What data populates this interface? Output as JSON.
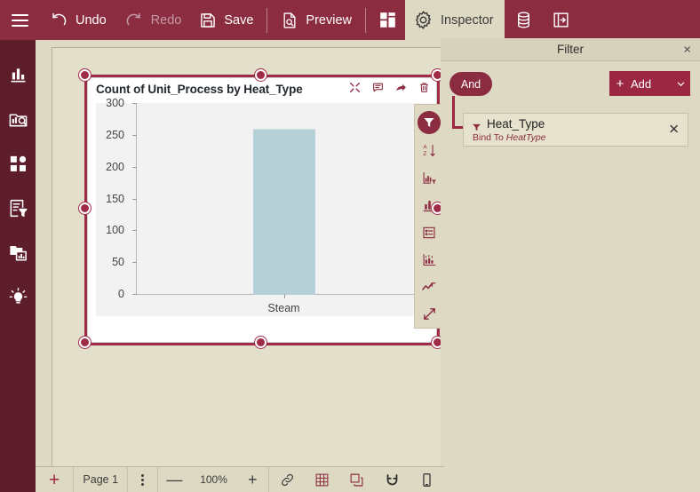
{
  "toolbar": {
    "menu_icon": "hamburger-icon",
    "items": [
      {
        "label": "Undo",
        "icon": "undo-icon",
        "enabled": true
      },
      {
        "label": "Redo",
        "icon": "redo-icon",
        "enabled": false
      },
      {
        "label": "Save",
        "icon": "save-icon",
        "enabled": true
      },
      {
        "label": "Preview",
        "icon": "preview-icon",
        "enabled": true
      }
    ],
    "layout_icon": "layout-grid-icon",
    "inspector_label": "Inspector",
    "inspector_icon": "gear-icon",
    "data_icon": "database-icon",
    "panel_icon": "side-panel-icon",
    "background": "#8c2c40",
    "active_background": "#ddd9c3"
  },
  "sidebar": {
    "background": "#5e1d2b",
    "items": [
      {
        "name": "sidebar-item-charts",
        "icon": "bar-chart-icon"
      },
      {
        "name": "sidebar-item-explore",
        "icon": "chart-search-icon"
      },
      {
        "name": "sidebar-item-components",
        "icon": "grid-shapes-icon"
      },
      {
        "name": "sidebar-item-filters",
        "icon": "form-filter-icon"
      },
      {
        "name": "sidebar-item-datasets",
        "icon": "folder-chart-icon"
      },
      {
        "name": "sidebar-item-insights",
        "icon": "lightbulb-icon"
      }
    ]
  },
  "chart_data": {
    "type": "bar",
    "title": "Count of Unit_Process by Heat_Type",
    "categories": [
      "Steam"
    ],
    "values": [
      260
    ],
    "xlabel": "",
    "ylabel": "",
    "ylim": [
      0,
      300
    ],
    "yticks": [
      0,
      50,
      100,
      150,
      200,
      250,
      300
    ],
    "grid": false,
    "legend": false,
    "bar_color": "#b5d0d7",
    "plot_background": "#f2f2f2"
  },
  "widget": {
    "selected": true,
    "icons": [
      {
        "name": "expand-icon",
        "label": "Expand"
      },
      {
        "name": "comment-icon",
        "label": "Comment"
      },
      {
        "name": "share-icon",
        "label": "Share"
      },
      {
        "name": "delete-icon",
        "label": "Delete"
      }
    ],
    "tools": [
      {
        "name": "filter-icon",
        "selected": true
      },
      {
        "name": "sort-az-icon",
        "selected": false
      },
      {
        "name": "chart-filter-icon",
        "selected": false
      },
      {
        "name": "bar-chart-icon",
        "selected": false
      },
      {
        "name": "table-icon",
        "selected": false
      },
      {
        "name": "statistics-icon",
        "selected": false
      },
      {
        "name": "trend-line-icon",
        "selected": false
      },
      {
        "name": "resize-icon",
        "selected": false
      }
    ]
  },
  "filter_panel": {
    "title": "Filter",
    "close_label": "×",
    "operator": "And",
    "add_label": "Add",
    "add_plus": "+",
    "add_caret": "⌄",
    "cards": [
      {
        "name": "Heat_Type",
        "bind_prefix": "Bind To",
        "bind_value": "HeatType",
        "remove_label": "✕"
      }
    ],
    "accent": "#9b2743"
  },
  "statusbar": {
    "add_page": "+",
    "page_label": "Page 1",
    "more_label": "kebab-icon",
    "zoom_out": "—",
    "zoom_level": "100%",
    "zoom_in": "+",
    "tools": [
      {
        "name": "link-icon"
      },
      {
        "name": "grid-icon"
      },
      {
        "name": "layers-icon"
      },
      {
        "name": "magnet-icon"
      },
      {
        "name": "mobile-icon"
      }
    ]
  }
}
